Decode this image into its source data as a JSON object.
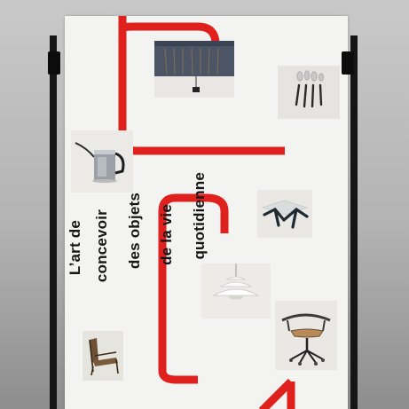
{
  "poster": {
    "lines": [
      "L’art de",
      "concevoir",
      "des objets",
      "de la vie",
      "quotidienne"
    ]
  },
  "colors": {
    "accent_red": "#e0201c",
    "poster_paper": "#f3f3f1",
    "stand": "#151515"
  },
  "photos": [
    "pendant-lamp-photo",
    "cutlery-set-photo",
    "teapot-photo",
    "coffee-table-photo",
    "ph-lamp-photo",
    "swivel-chair-photo",
    "lounge-chair-photo"
  ]
}
